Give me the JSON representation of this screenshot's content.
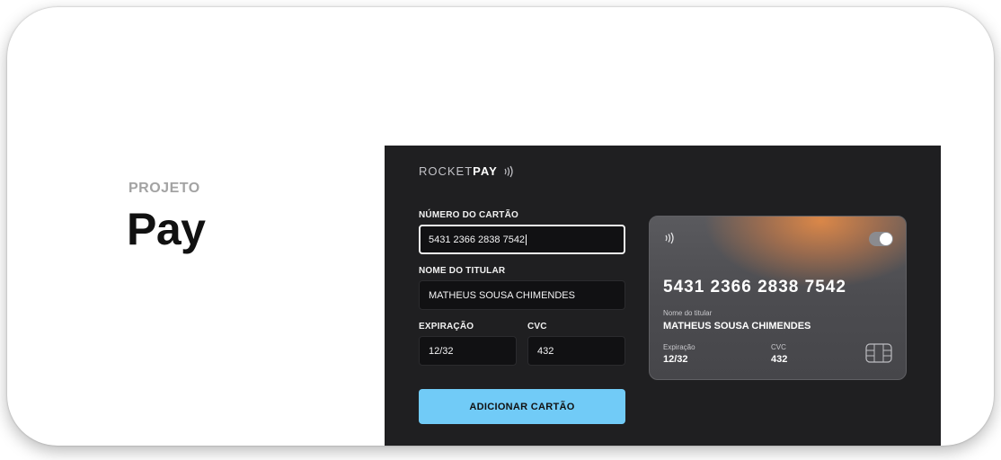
{
  "hero": {
    "eyebrow": "PROJETO",
    "title": "Pay"
  },
  "brand": {
    "light": "ROCKET",
    "bold": "PAY",
    "icon": "contactless-icon"
  },
  "form": {
    "card_number": {
      "label": "NÚMERO DO CARTÃO",
      "value": "5431 2366 2838 7542"
    },
    "holder_name": {
      "label": "NOME DO TITULAR",
      "value": "MATHEUS SOUSA CHIMENDES"
    },
    "expiration": {
      "label": "EXPIRAÇÃO",
      "value": "12/32"
    },
    "cvc": {
      "label": "CVC",
      "value": "432"
    },
    "submit_label": "ADICIONAR CARTÃO"
  },
  "card": {
    "number": "5431 2366 2838 7542",
    "holder_label": "Nome do titular",
    "holder_value": "MATHEUS SOUSA CHIMENDES",
    "expiration_label": "Expiração",
    "expiration_value": "12/32",
    "cvc_label": "CVC",
    "cvc_value": "432"
  },
  "colors": {
    "app_background": "#1f1f21",
    "accent": "#71cbf7",
    "card_glow": "#e88c46"
  }
}
